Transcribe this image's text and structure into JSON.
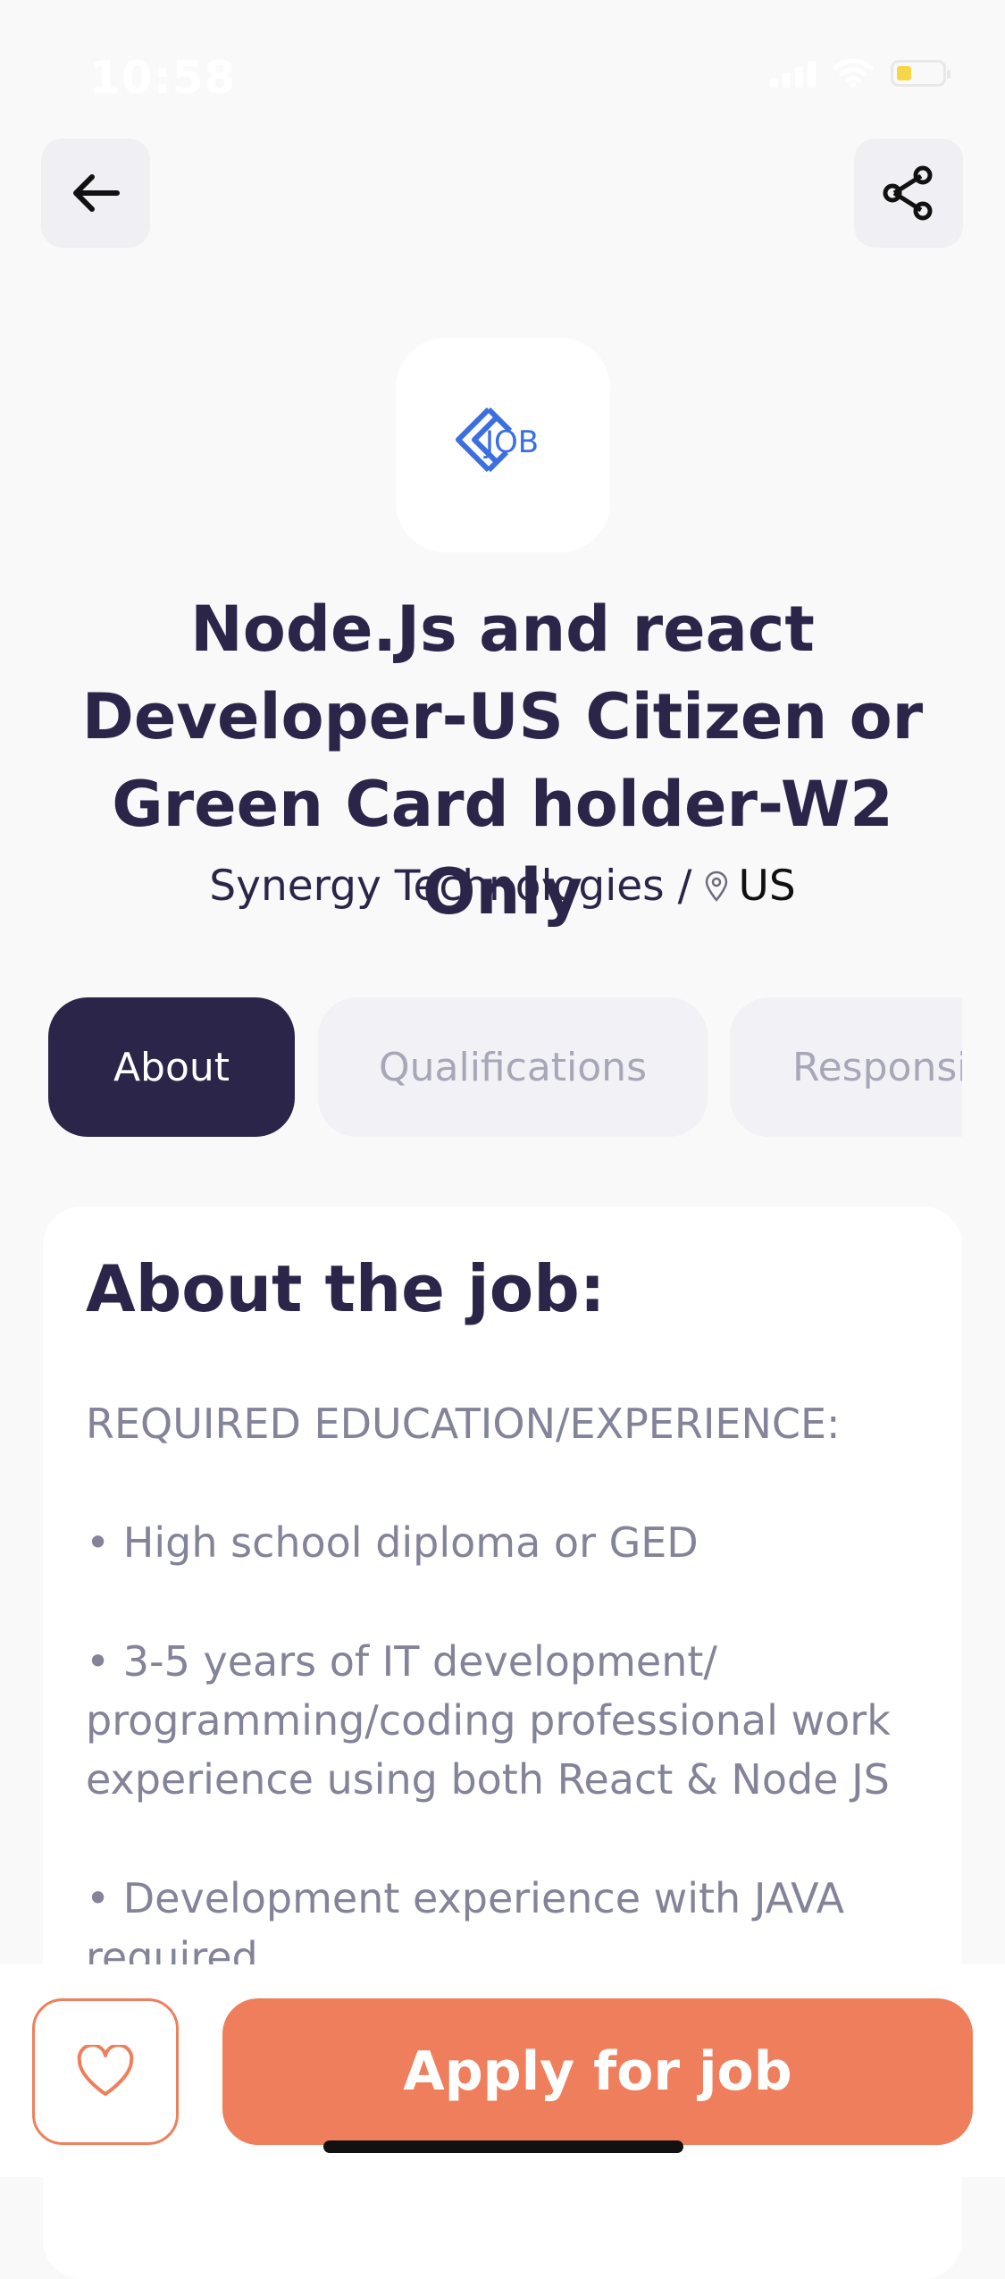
{
  "status_bar": {
    "time": "10:58"
  },
  "job": {
    "title_lines": [
      "Node.Js and react",
      "Developer-US Citizen or",
      "Green Card holder-W2 Only"
    ],
    "company": "Synergy Technologies /",
    "location": "US",
    "logo_text": "JOB"
  },
  "tabs": [
    "About",
    "Qualifications",
    "Responsibilities"
  ],
  "about": {
    "heading": "About the job:",
    "paragraphs": [
      "REQUIRED EDUCATION/EXPERIENCE:",
      "• High school diploma or GED",
      "• 3-5 years of IT development/ programming/coding professional work experience using both React & Node JS",
      "• Development experience with JAVA required"
    ]
  },
  "actions": {
    "apply_label": "Apply for job"
  },
  "colors": {
    "primary": "#2b2549",
    "accent": "#ef7f5c",
    "logo": "#3b6fe0"
  },
  "icons": {
    "back": "arrow-left-icon",
    "share": "share-icon",
    "favorite": "heart-icon",
    "location": "map-pin-icon"
  }
}
